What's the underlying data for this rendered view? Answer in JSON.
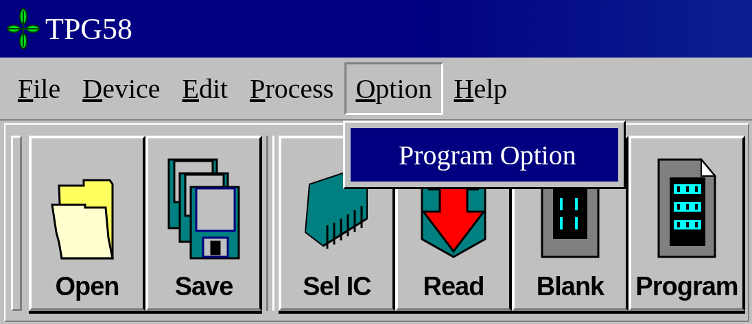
{
  "window": {
    "title": "TPG58"
  },
  "menu": [
    {
      "label": "File",
      "selected": false
    },
    {
      "label": "Device",
      "selected": false
    },
    {
      "label": "Edit",
      "selected": false
    },
    {
      "label": "Process",
      "selected": false
    },
    {
      "label": "Option",
      "selected": true
    },
    {
      "label": "Help",
      "selected": false
    }
  ],
  "dropdown": {
    "items": [
      {
        "label": "Program Option",
        "selected": true
      }
    ]
  },
  "toolbar": {
    "groups": [
      [
        {
          "label": "Open",
          "kind": "folder"
        },
        {
          "label": "Save",
          "kind": "floppy"
        }
      ],
      [
        {
          "label": "Sel IC",
          "kind": "chip"
        },
        {
          "label": "Read",
          "kind": "read"
        },
        {
          "label": "Blank",
          "kind": "blank"
        },
        {
          "label": "Program",
          "kind": "program"
        }
      ]
    ]
  }
}
